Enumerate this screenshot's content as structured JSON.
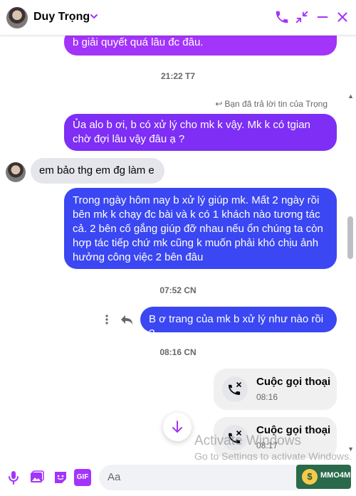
{
  "header": {
    "contact_name": "Duy Trọng",
    "icons": [
      "chevron-down-icon",
      "phone-icon",
      "minimize-icon",
      "minus-icon",
      "close-icon"
    ],
    "accent_color": "#a334fa"
  },
  "messages": {
    "m1": "b giải quyết quá lâu đc đâu.",
    "t1": "21:22 T7",
    "replied_note": "Bạn đã trả lời tin của Trọng",
    "m2": "Ủa alo b ơi, b có xử lý cho mk k vậy. Mk k có tgian chờ đợi lâu vậy đâu ạ ?",
    "m3": "em bảo thg em đg làm e",
    "m4": "Trong ngày hôm nay b xử lý giúp mk. Mất 2 ngày rồi bên mk k chạy đc bài và k có 1 khách nào tương tác cả. 2 bên cố gắng giúp đỡ nhau nếu ổn chúng ta còn hợp tác tiếp chứ mk cũng k muốn phải khó chịu ảnh hưởng công việc 2 bên đâu",
    "t2": "07:52 CN",
    "m5": "B ơ trang của mk b xử lý như nào rồi ?",
    "t3": "08:16 CN"
  },
  "calls": [
    {
      "title": "Cuộc gọi thoại",
      "time": "08:16"
    },
    {
      "title": "Cuộc gọi thoại",
      "time": "08:17"
    }
  ],
  "watermark": {
    "line1": "Activate Windows",
    "line2": "Go to Settings to activate Windows."
  },
  "footer": {
    "placeholder": "Aa",
    "gif_label": "GIF",
    "badge_text": "MMO4ME",
    "badge_symbol": "$"
  }
}
